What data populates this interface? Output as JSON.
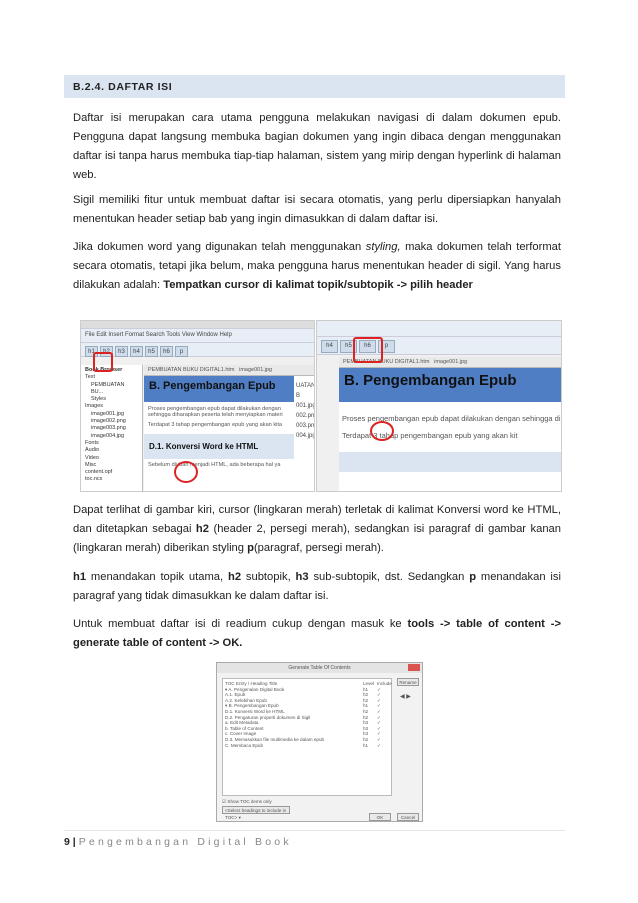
{
  "heading": "B.2.4.  DAFTAR ISI",
  "p1": "Daftar isi merupakan cara utama pengguna melakukan navigasi di dalam dokumen epub. Pengguna dapat langsung membuka bagian dokumen yang ingin dibaca dengan menggunakan daftar isi tanpa harus membuka tiap-tiap halaman, sistem yang mirip dengan hyperlink di halaman web.",
  "p2": "Sigil memiliki fitur untuk membuat daftar isi secara otomatis, yang perlu dipersiapkan hanyalah menentukan header setiap bab yang ingin dimasukkan di dalam daftar isi.",
  "p3": {
    "a": "Jika dokumen word yang digunakan telah menggunakan ",
    "i": "styling,",
    "b": " maka dokumen telah terformat secara otomatis, tetapi jika belum, maka pengguna harus menentukan header di sigil. Yang harus dilakukan adalah: ",
    "bold": "Tempatkan cursor di kalimat topik/subtopik -> pilih header"
  },
  "p4": {
    "a": "Dapat terlihat di gambar kiri, cursor (lingkaran merah) terletak di kalimat Konversi word ke HTML, dan ditetapkan sebagai ",
    "b1": "h2",
    "b": " (header 2, persegi merah), sedangkan isi paragraf di gambar kanan (lingkaran merah) diberikan styling ",
    "b2": "p",
    "c": "(paragraf, persegi merah)."
  },
  "p5": {
    "b1": "h1",
    "a": " menandakan topik utama, ",
    "b2": "h2",
    "b": " subtopik, ",
    "b3": "h3",
    "c": " sub-subtopik, dst. Sedangkan ",
    "b4": "p",
    "d": " menandakan isi paragraf yang tidak dimasukkan ke dalam daftar isi."
  },
  "p6": {
    "a": "Untuk membuat daftar isi di readium cukup dengan masuk ke ",
    "bold": "tools -> table of content -> generate table of content -> OK."
  },
  "left_shot": {
    "menu": "File  Edit  Insert  Format  Search  Tools  View  Window  Help",
    "heading_tools": [
      "h1",
      "h2",
      "h3",
      "h4",
      "h5",
      "h6",
      "p"
    ],
    "book_browser": "Book Browser",
    "tree": [
      "Text",
      "PEMBUATAN BU...",
      "Styles",
      "Images",
      "image001.jpg",
      "image002.png",
      "image003.png",
      "image004.jpg",
      "Fonts",
      "Audio",
      "Video",
      "Misc",
      "content.opf",
      "toc.ncx"
    ],
    "tabs": [
      "PEMBUATAN BUKU DIGITAL1.htm",
      "image001.jpg"
    ],
    "doc_h1": "B.  Pengembangan Epub",
    "doc_p1": "Proses pengembangan epub dapat dilakukan dengan sehingga diharapkan peserta telah menyiapkan materi",
    "doc_p2": "Terdapat 3 tahap pengembangan epub yang akan kita",
    "doc_h2": "D.1.   Konversi Word ke HTML",
    "doc_p3": "Sebelum diubah menjadi HTML, ada beberapa hal ya",
    "behind": [
      "UATAN B",
      "001.jpg",
      "002.png",
      "003.png",
      "004.jpg"
    ]
  },
  "right_shot": {
    "heading_tools": [
      "h4",
      "h5",
      "h6",
      "p"
    ],
    "tabs": [
      "PEMBUATAN BUKU DIGITAL1.htm",
      "image001.jpg"
    ],
    "doc_h1": "B.  Pengembangan Epub",
    "doc_p1": "Proses pengembangan epub dapat dilakukan dengan sehingga diharapkan peserta telah menyiapkan mate",
    "doc_p2": "Terdapat 3 tahap pengembangan epub yang akan kit"
  },
  "dialog": {
    "title": "Generate Table Of Contents",
    "columns": [
      "TOC Entry / Heading Title",
      "Level",
      "Include"
    ],
    "rows": [
      [
        "▾ A. Pengenalan Digital Book",
        "h1",
        "✓"
      ],
      [
        "   A.1. Epub",
        "h2",
        "✓"
      ],
      [
        "   A.2. Kelebihan Epub",
        "h2",
        "✓"
      ],
      [
        "▾ B. Pengembangan Epub",
        "h1",
        "✓"
      ],
      [
        "   D.1. Konversi Word ke HTML",
        "h2",
        "✓"
      ],
      [
        "   D.2. Pengaturan properti dokumen di Sigil",
        "h2",
        "✓"
      ],
      [
        "   a. Edit Metadata",
        "h3",
        "✓"
      ],
      [
        "   b. Table of Content",
        "h3",
        "✓"
      ],
      [
        "   c. Cover Image",
        "h3",
        "✓"
      ],
      [
        "   D.3. Memasukkan file multimedia ke dalam epub",
        "h2",
        "✓"
      ],
      [
        "  C. Membaca Epub",
        "h1",
        "✓"
      ]
    ],
    "rename": "Rename",
    "show_toc": "Show TOC items only",
    "select": "<Select headings to include in TOC>",
    "ok": "OK",
    "cancel": "Cancel"
  },
  "footer": {
    "page": "9 |",
    "title": "Pengembangan Digital Book"
  }
}
